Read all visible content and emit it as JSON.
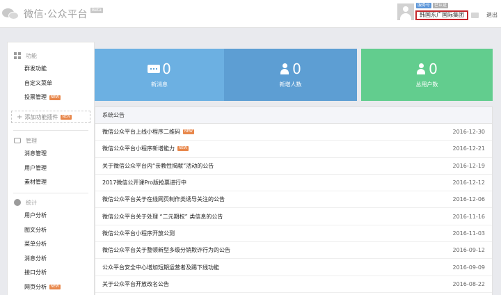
{
  "header": {
    "logo_text": "微信·公众平台",
    "beta_badge": "Beta",
    "account_tags": [
      "服务号",
      "已认证"
    ],
    "account_name": "韩国东广国际集团",
    "logout_label": "退出"
  },
  "sidebar": {
    "function": {
      "title": "功能",
      "items": [
        {
          "label": "群发功能",
          "new": false
        },
        {
          "label": "自定义菜单",
          "new": false
        },
        {
          "label": "投票管理",
          "new": true
        }
      ],
      "add_plugin_label": "添加功能插件"
    },
    "manage": {
      "title": "管理",
      "items": [
        {
          "label": "消息管理"
        },
        {
          "label": "用户管理"
        },
        {
          "label": "素材管理"
        }
      ]
    },
    "stats": {
      "title": "统计",
      "items": [
        {
          "label": "用户分析",
          "new": false
        },
        {
          "label": "图文分析",
          "new": false
        },
        {
          "label": "菜单分析",
          "new": false
        },
        {
          "label": "消息分析",
          "new": false
        },
        {
          "label": "接口分析",
          "new": false
        },
        {
          "label": "网页分析",
          "new": true
        }
      ]
    },
    "new_badge": "NEW"
  },
  "stats_cards": [
    {
      "value": "0",
      "label": "新消息",
      "color": "#6cb0e2"
    },
    {
      "value": "0",
      "label": "新增人数",
      "color": "#5d9ed3"
    },
    {
      "value": "0",
      "label": "总用户数",
      "color": "#62cd8e"
    }
  ],
  "announcements": {
    "title": "系统公告",
    "items": [
      {
        "title": "微信公众平台上线小程序二维码",
        "date": "2016-12-30",
        "new": true
      },
      {
        "title": "微信公众平台小程序新增能力",
        "date": "2016-12-21",
        "new": true
      },
      {
        "title": "关于微信公众平台内“亲教性揭献”活动的公告",
        "date": "2016-12-19",
        "new": false
      },
      {
        "title": "2017微信公开课Pro版抢票进行中",
        "date": "2016-12-12",
        "new": false
      },
      {
        "title": "微信公众平台关于在线网页制作类诱导关注的公告",
        "date": "2016-12-06",
        "new": false
      },
      {
        "title": "微信公众平台关于处理 “二元期权” 类信息的公告",
        "date": "2016-11-16",
        "new": false
      },
      {
        "title": "微信公众平台小程序开放公测",
        "date": "2016-11-03",
        "new": false
      },
      {
        "title": "微信公众平台关于整顿新型多级分销欺诈行为的公告",
        "date": "2016-09-12",
        "new": false
      },
      {
        "title": "公众平台安全中心增加短期运营者及踢下线功能",
        "date": "2016-09-09",
        "new": false
      },
      {
        "title": "关于公众平台开放改名公告",
        "date": "2016-08-22",
        "new": false
      }
    ]
  }
}
